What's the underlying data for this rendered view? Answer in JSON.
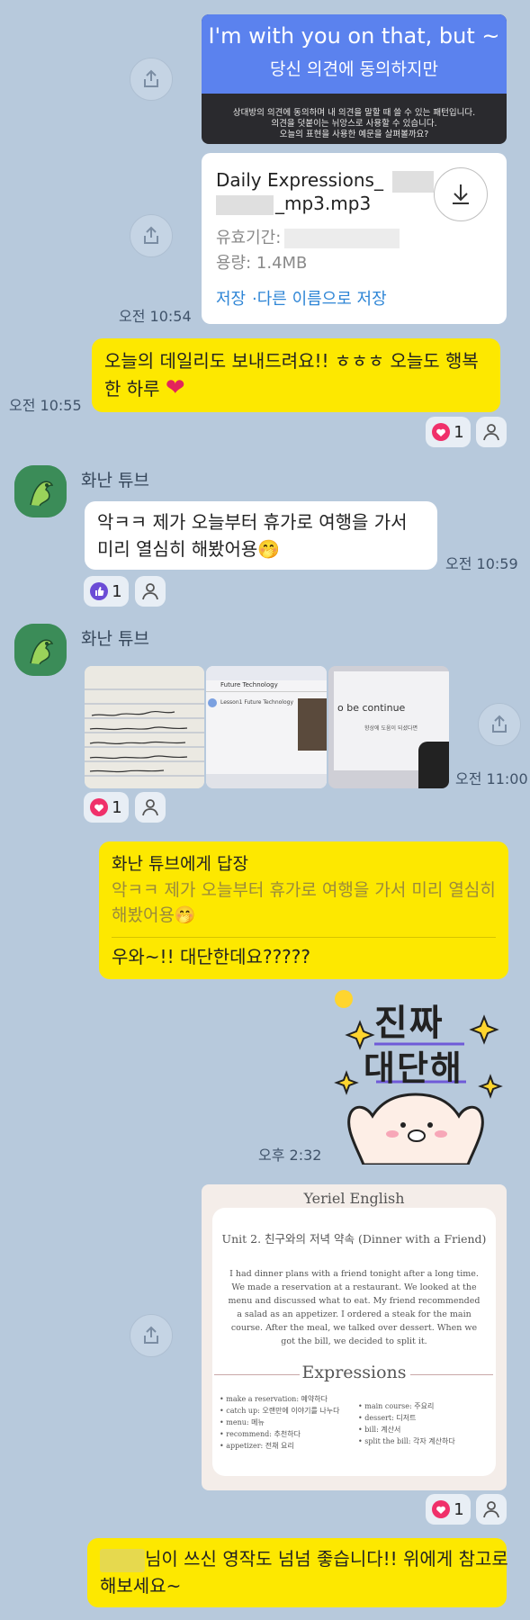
{
  "colors": {
    "background": "#b7c9dc",
    "my_bubble": "#fde800",
    "their_bubble": "#ffffff",
    "link": "#2f86d6",
    "heart": "#f0306a",
    "like": "#6b4cd6"
  },
  "banner": {
    "title": "I'm with you on that, but ~",
    "subtitle": "당신 의견에 동의하지만",
    "desc_lines": [
      "상대방의 의견에 동의하며 내 의견을 말할 때 쓸 수 있는 패턴입니다.",
      "의견을 덧붙이는 뉘앙스로 사용할 수 있습니다.",
      "오늘의 표현을 사용한 예문을 살펴볼까요?"
    ]
  },
  "file": {
    "name_line1": "Daily Expressions_",
    "name_line2": "_mp3.mp3",
    "expiry_label": "유효기간:",
    "size": "용량: 1.4MB",
    "save": "저장",
    "save_as": "·다른 이름으로 저장",
    "time": "오전 10:54"
  },
  "msg1": {
    "text": "오늘의 데일리도 보내드려요!! ㅎㅎㅎ 오늘도 행복한 하루 ",
    "emoji": "❤",
    "time": "오전 10:55",
    "reaction_count": "1"
  },
  "msg2": {
    "sender": "화난 튜브",
    "text": "악ㅋㅋ 제가 오늘부터 휴가로 여행을 가서 미리 열심히 해봤어용",
    "emoji": "🤭",
    "time": "오전 10:59",
    "reaction_count": "1"
  },
  "msg3": {
    "sender": "화난 튜브",
    "time": "오전 11:00",
    "reaction_count": "1",
    "thumb2_title": "Future Technology",
    "thumb2_lesson": "Lesson1 Future Technology",
    "thumb3_text": "o be continue",
    "thumb3_sub": "향상에 도움이 되셨다면"
  },
  "reply": {
    "header": "화난 튜브에게 답장",
    "quote": "악ㅋㅋ 제가 오늘부터 휴가로 여행을 가서 미리 열심히 해봤어용",
    "quote_emoji": "🤭",
    "text": "우와~!! 대단한데요?????"
  },
  "sticker": {
    "line1": "진짜",
    "line2": "대단해",
    "time": "오후 2:32"
  },
  "lesson": {
    "brand": "Yeriel English",
    "unit": "Unit 2. 친구와의 저녁 약속 (Dinner with a Friend)",
    "paragraph": "I had dinner plans with a friend tonight after a long time. We made a reservation at a restaurant. We looked at the menu and discussed what to eat. My friend recommended a salad as an appetizer. I ordered a steak for the main course. After the meal, we talked over dessert. When we got the bill, we decided to split it.",
    "expr_title": "Expressions",
    "expr_left": [
      "make a reservation: 예약하다",
      "catch up: 오랜만에 이야기를 나누다",
      "menu: 메뉴",
      "recommend: 추천하다",
      "appetizer: 전채 요리"
    ],
    "expr_right": [
      "main course: 주요리",
      "dessert: 디저트",
      "bill: 계산서",
      "split the bill: 각자 계산하다"
    ],
    "reaction_count": "1"
  },
  "msg_last": {
    "text_line1": "님이 쓰신 영작도 넘넘 좋습니다!! 위에게 참고로",
    "text_line2": "해보세요~"
  }
}
